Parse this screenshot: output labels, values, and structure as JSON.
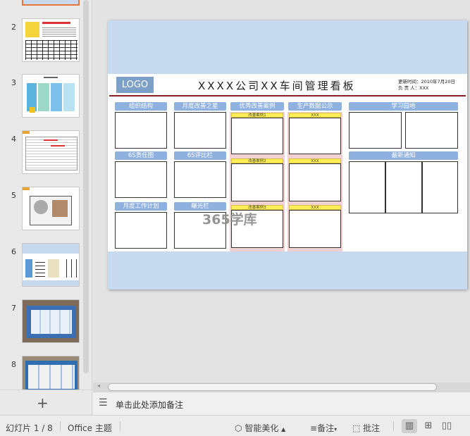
{
  "thumbnails": [
    {
      "number": "2"
    },
    {
      "number": "3"
    },
    {
      "number": "4"
    },
    {
      "number": "5"
    },
    {
      "number": "6"
    },
    {
      "number": "7"
    },
    {
      "number": "8"
    }
  ],
  "slide": {
    "logo": "LOGO",
    "title": "XXXX公司XX车间管理看板",
    "meta_update": "更新时间：2010年7月20日",
    "meta_owner": "负 责 人：XXX",
    "columns": {
      "c1": [
        "组织结构",
        "6S责任图",
        "月度工作计划"
      ],
      "c2": [
        "月度改善之星",
        "6S评比栏",
        "曝光栏"
      ],
      "c3": "优秀改善案例",
      "c4": "生产数据公示",
      "c5": [
        "学习园地",
        "最新通知"
      ]
    },
    "case_labels": [
      "改善案例1",
      "改善案例2",
      "改善案例3"
    ],
    "data_labels": [
      "XXX",
      "XXX",
      "XXX"
    ],
    "watermark": "365学库"
  },
  "notes_placeholder": "单击此处添加备注",
  "status": {
    "slide_counter": "幻灯片 1 / 8",
    "theme": "Office 主题",
    "smart_beautify": "智能美化",
    "notes": "备注",
    "comments": "批注"
  },
  "colors": {
    "accent": "#e8753a",
    "slide_bg": "#c6d9ef",
    "header_blue": "#8fb1e0",
    "title_rule": "#8b2121"
  }
}
